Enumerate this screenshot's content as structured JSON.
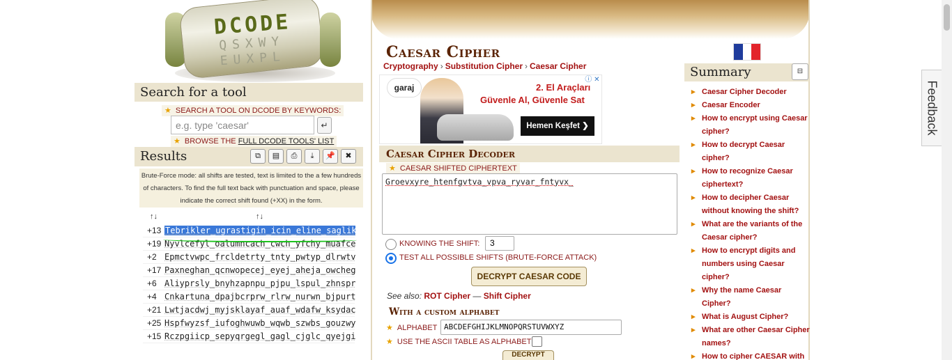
{
  "logo": {
    "word": "DCODE",
    "rows": [
      "QSXWY",
      "EUXPL"
    ]
  },
  "search": {
    "heading": "Search for a tool",
    "keyword_label": "SEARCH A TOOL ON DCODE BY KEYWORDS:",
    "placeholder": "e.g. type 'caesar'",
    "go_glyph": "↵",
    "browse_prefix": "BROWSE THE ",
    "browse_link": "FULL DCODE TOOLS' LIST"
  },
  "results": {
    "heading": "Results",
    "tool_icons": [
      "copy-icon",
      "clipboard-icon",
      "print-icon",
      "download-icon",
      "pin-icon",
      "close-icon"
    ],
    "tool_glyphs": [
      "⧉",
      "▤",
      "⎙",
      "⤓",
      "📌",
      "✖"
    ],
    "note": "Brute-Force mode: all shifts are tested, text is limited to the a few hundreds of characters. To find the full text back with punctuation and space, please indicate the correct shift found (+XX) in the form.",
    "col_headers": [
      "↑↓",
      "↑↓"
    ],
    "rows": [
      {
        "shift": "+13",
        "text": "Tebrikler_ugrastigin_icin_eline_saglik",
        "selected": true
      },
      {
        "shift": "+19",
        "text": "Nyvlcefyl_oalumncach_cwch_yfchy_muafce_",
        "selected": false
      },
      {
        "shift": "+2",
        "text": "Epmctvwpc_frcldetrty_tnty_pwtyp_dlrwtv_",
        "selected": false
      },
      {
        "shift": "+17",
        "text": "Paxneghan_qcnwopecej_eyej_aheja_owcheg_",
        "selected": false
      },
      {
        "shift": "+6",
        "text": "Aliyprsly_bnyhzapnpu_pjpu_lspul_zhnspr_",
        "selected": false
      },
      {
        "shift": "+4",
        "text": "Cnkartuna_dpajbcrprw_rlrw_nurwn_bjpurt_",
        "selected": false
      },
      {
        "shift": "+21",
        "text": "Lwtjacdwj_myjsklayaf_auaf_wdafw_ksydac_",
        "selected": false
      },
      {
        "shift": "+25",
        "text": "Hspfwyzsf_iufoghwuwb_wqwb_szwbs_gouzwy_",
        "selected": false
      },
      {
        "shift": "+15",
        "text": "Rczpgiicp_sepyqrgegl_gagl_cjglc_qyejgi_",
        "selected": false
      }
    ]
  },
  "page": {
    "title": "Caesar Cipher",
    "breadcrumbs": [
      "Cryptography",
      "Substitution Cipher",
      "Caesar Cipher"
    ],
    "crumb_sep": "›"
  },
  "ad": {
    "brand": "garaj",
    "line1": "2. El Araçları",
    "line2": "Güvenle Al, Güvenle Sat",
    "cta": "Hemen Keşfet ❯",
    "close_glyphs": "ⓘ ✕"
  },
  "decoder": {
    "heading": "Caesar Cipher Decoder",
    "ciphertext_label": "CAESAR SHIFTED CIPHERTEXT",
    "ciphertext": "Groevxyre_htenfgvtva_vpva_ryvar_fntyvx_",
    "known_shift_label": "KNOWING THE SHIFT:",
    "shift_value": "3",
    "bruteforce_label": "TEST ALL POSSIBLE SHIFTS (BRUTE-FORCE ATTACK)",
    "selected_option": "bruteforce",
    "decrypt_button": "DECRYPT CAESAR CODE",
    "see_also_label": "See also:",
    "see_also_1": "ROT Cipher",
    "see_also_sep": "—",
    "see_also_2": "Shift Cipher",
    "custom_heading": "With a custom alphabet",
    "alphabet_label": "ALPHABET",
    "alphabet_value": "ABCDEFGHIJKLMNOPQRSTUVWXYZ",
    "ascii_label": "USE THE ASCII TABLE AS ALPHABET",
    "ascii_checked": false,
    "decrypt_button_2": "DECRYPT"
  },
  "summary": {
    "heading": "Summary",
    "toggle_glyph": "⊟",
    "items": [
      "Caesar Cipher Decoder",
      "Caesar Encoder",
      "How to encrypt using Caesar cipher?",
      "How to decrypt Caesar cipher?",
      "How to recognize Caesar ciphertext?",
      "How to decipher Caesar without knowing the shift?",
      "What are the variants of the Caesar cipher?",
      "How to encrypt digits and numbers using Caesar cipher?",
      "Why the name Caesar Cipher?",
      "What is August Cipher?",
      "What are other Caesar Cipher names?",
      "How to cipher CAESAR with the Caesar code?"
    ]
  },
  "flag": {
    "colors": [
      "#1f3c9c",
      "#ffffff",
      "#e3242b"
    ]
  },
  "feedback": {
    "label": "Feedback"
  },
  "colors": {
    "accent_red": "#a31212",
    "heading_brown": "#5b2406",
    "section_bg": "#ebe4cf",
    "selection_blue": "#3a78d8"
  }
}
